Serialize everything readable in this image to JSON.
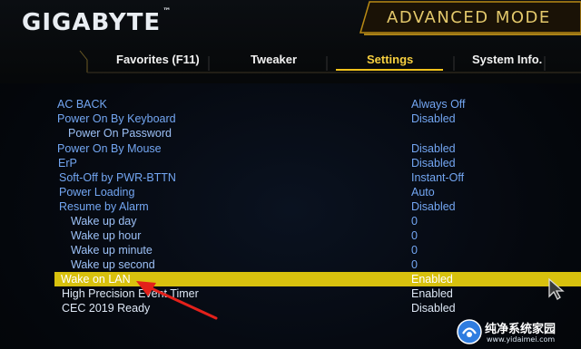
{
  "header": {
    "brand": "GIGABYTE",
    "brand_tm": "™",
    "mode_title": "ADVANCED MODE"
  },
  "tabs": [
    {
      "label": "Favorites (F11)",
      "active": false
    },
    {
      "label": "Tweaker",
      "active": false
    },
    {
      "label": "Settings",
      "active": true
    },
    {
      "label": "System Info.",
      "active": false
    }
  ],
  "settings": [
    {
      "label": "AC BACK",
      "value": "Always Off"
    },
    {
      "label": "Power On By Keyboard",
      "value": "Disabled"
    },
    {
      "label": "Power On Password",
      "value": ""
    },
    {
      "label": "Power On By Mouse",
      "value": "Disabled"
    },
    {
      "label": "ErP",
      "value": "Disabled"
    },
    {
      "label": "Soft-Off by PWR-BTTN",
      "value": "Instant-Off"
    },
    {
      "label": "Power Loading",
      "value": "Auto"
    },
    {
      "label": "Resume by Alarm",
      "value": "Disabled"
    },
    {
      "label": "Wake up day",
      "value": "0"
    },
    {
      "label": "Wake up hour",
      "value": "0"
    },
    {
      "label": "Wake up minute",
      "value": "0"
    },
    {
      "label": "Wake up second",
      "value": "0"
    },
    {
      "label": "Wake on LAN",
      "value": "Enabled",
      "selected": true
    },
    {
      "label": "High Precision Event Timer",
      "value": "Enabled"
    },
    {
      "label": "CEC 2019 Ready",
      "value": "Disabled"
    }
  ],
  "colors": {
    "accent": "#f2c21b",
    "highlight": "#d8c10e",
    "setting_text": "#73a6f2"
  },
  "watermark": {
    "title": "纯净系统家园",
    "url": "www.yidaimei.com"
  }
}
